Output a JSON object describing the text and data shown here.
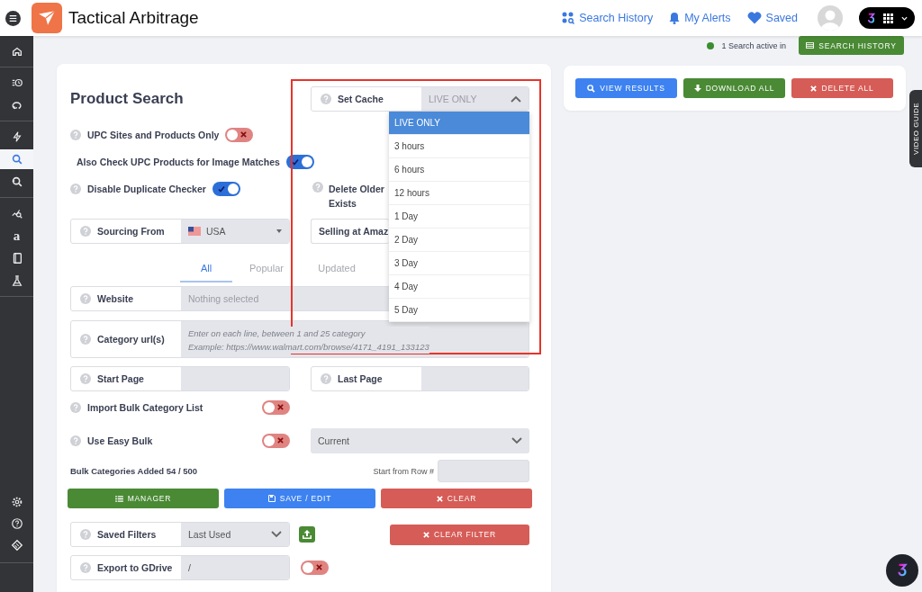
{
  "header": {
    "title": "Tactical Arbitrage",
    "links": [
      {
        "label": "Search History"
      },
      {
        "label": "My Alerts"
      },
      {
        "label": "Saved"
      }
    ]
  },
  "sidebar": {
    "groups": [
      [
        {
          "selected": false
        }
      ],
      [
        {
          "selected": false
        },
        {
          "selected": false
        }
      ],
      [
        {
          "selected": false
        },
        {
          "selected": true
        },
        {
          "selected": false
        }
      ],
      [
        {
          "selected": false
        },
        {
          "label": "a",
          "selected": false
        },
        {
          "selected": false
        },
        {
          "selected": false
        }
      ]
    ],
    "bottom": [
      {
        "selected": false
      },
      {
        "selected": false
      },
      {
        "selected": false
      }
    ]
  },
  "status": {
    "text": "1 Search active in",
    "button": "SEARCH HISTORY"
  },
  "product_search": {
    "title": "Product Search",
    "set_cache": {
      "label": "Set Cache",
      "placeholder": "LIVE ONLY",
      "expanded": true,
      "options": [
        {
          "label": "LIVE ONLY",
          "selected": true
        },
        {
          "label": "3 hours",
          "selected": false
        },
        {
          "label": "6 hours",
          "selected": false
        },
        {
          "label": "12 hours",
          "selected": false
        },
        {
          "label": "1 Day",
          "selected": false
        },
        {
          "label": "2 Day",
          "selected": false
        },
        {
          "label": "3 Day",
          "selected": false
        },
        {
          "label": "4 Day",
          "selected": false
        },
        {
          "label": "5 Day",
          "selected": false
        }
      ]
    },
    "toggles": [
      {
        "label": "UPC Sites and Products Only",
        "on": false
      },
      {
        "label": "Also Check UPC Products for Image Matches",
        "on": true
      },
      {
        "label": "Disable Duplicate Checker",
        "on": true
      }
    ],
    "delete_older": {
      "lines": [
        "Delete Older",
        "Exists"
      ]
    },
    "sourcing": {
      "label": "Sourcing From",
      "value": "USA"
    },
    "selling": {
      "label": "Selling at Amaz"
    },
    "tabs": [
      {
        "label": "All",
        "selected": true
      },
      {
        "label": "Popular",
        "selected": false
      },
      {
        "label": "Updated",
        "selected": false
      }
    ],
    "website": {
      "label": "Website",
      "placeholder": "Nothing selected"
    },
    "category": {
      "label": "Category url(s)",
      "placeholder_lines": [
        "Enter on each line, between 1 and 25 category",
        "Example: https://www.walmart.com/browse/4171_4191_133123"
      ]
    },
    "start_page": {
      "label": "Start Page"
    },
    "last_page": {
      "label": "Last Page"
    },
    "import_bulk": {
      "label": "Import Bulk Category List",
      "on": false
    },
    "easy_bulk": {
      "label": "Use Easy Bulk",
      "on": false,
      "value": "Current"
    },
    "bulk_count": "Bulk Categories Added 54 / 500",
    "start_row": {
      "label": "Start from Row #"
    },
    "bulk_buttons": [
      {
        "label": "MANAGER",
        "kind": "manager"
      },
      {
        "label": "SAVE / EDIT",
        "kind": "save"
      },
      {
        "label": "CLEAR",
        "kind": "clear"
      }
    ],
    "saved_filters": {
      "label": "Saved Filters",
      "value": "Last Used"
    },
    "clear_filter": "CLEAR FILTER",
    "export": {
      "label": "Export to GDrive",
      "value": "/",
      "on": false
    }
  },
  "results_actions": [
    {
      "label": "VIEW RESULTS",
      "kind": "view"
    },
    {
      "label": "DOWNLOAD ALL",
      "kind": "download"
    },
    {
      "label": "DELETE ALL",
      "kind": "delete"
    }
  ],
  "video_guide": "VIDEO GUIDE"
}
